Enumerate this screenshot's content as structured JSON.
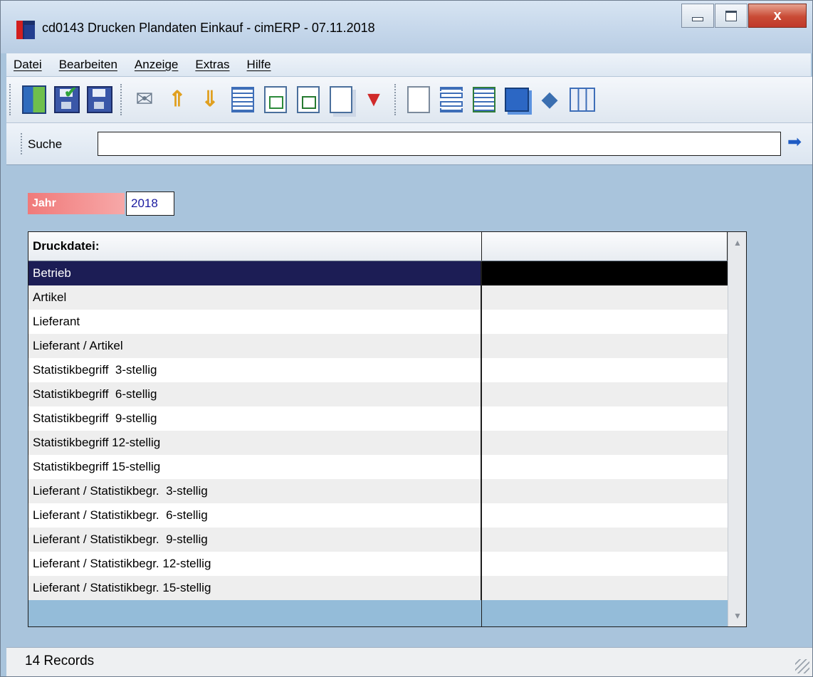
{
  "window": {
    "title": "cd0143 Drucken Plandaten Einkauf - cimERP - 07.11.2018",
    "controls": {
      "minimize": "–",
      "maximize": "□",
      "close": "x"
    }
  },
  "menu": {
    "items": [
      "Datei",
      "Bearbeiten",
      "Anzeige",
      "Extras",
      "Hilfe"
    ]
  },
  "toolbar": {
    "icons": [
      "exit-icon",
      "save-check-icon",
      "save-icon",
      "mail-icon",
      "sort-ascending-icon",
      "sort-descending-icon",
      "numbering-icon",
      "export-doc-icon",
      "export-excel-icon",
      "copy-icon",
      "filter-icon",
      "edit-icon",
      "select-area-icon",
      "list-transfer-icon",
      "windows-icon",
      "book-icon",
      "table-icon"
    ]
  },
  "search": {
    "label": "Suche",
    "value": "",
    "go_icon": "arrow-right-icon"
  },
  "jahr": {
    "label": "Jahr",
    "value": "2018"
  },
  "grid": {
    "columns": [
      "Druckdatei:",
      ""
    ],
    "rows": [
      "Betrieb",
      "Artikel",
      "Lieferant",
      "Lieferant / Artikel",
      "Statistikbegriff  3-stellig",
      "Statistikbegriff  6-stellig",
      "Statistikbegriff  9-stellig",
      "Statistikbegriff 12-stellig",
      "Statistikbegriff 15-stellig",
      "Lieferant / Statistikbegr.  3-stellig",
      "Lieferant / Statistikbegr.  6-stellig",
      "Lieferant / Statistikbegr.  9-stellig",
      "Lieferant / Statistikbegr. 12-stellig",
      "Lieferant / Statistikbegr. 15-stellig"
    ],
    "selected_index": 0
  },
  "status": {
    "text": "14 Records"
  },
  "colors": {
    "background": "#a9c4dc",
    "selected_row": "#1c1d55",
    "jahr_label": "#f07a7a"
  }
}
